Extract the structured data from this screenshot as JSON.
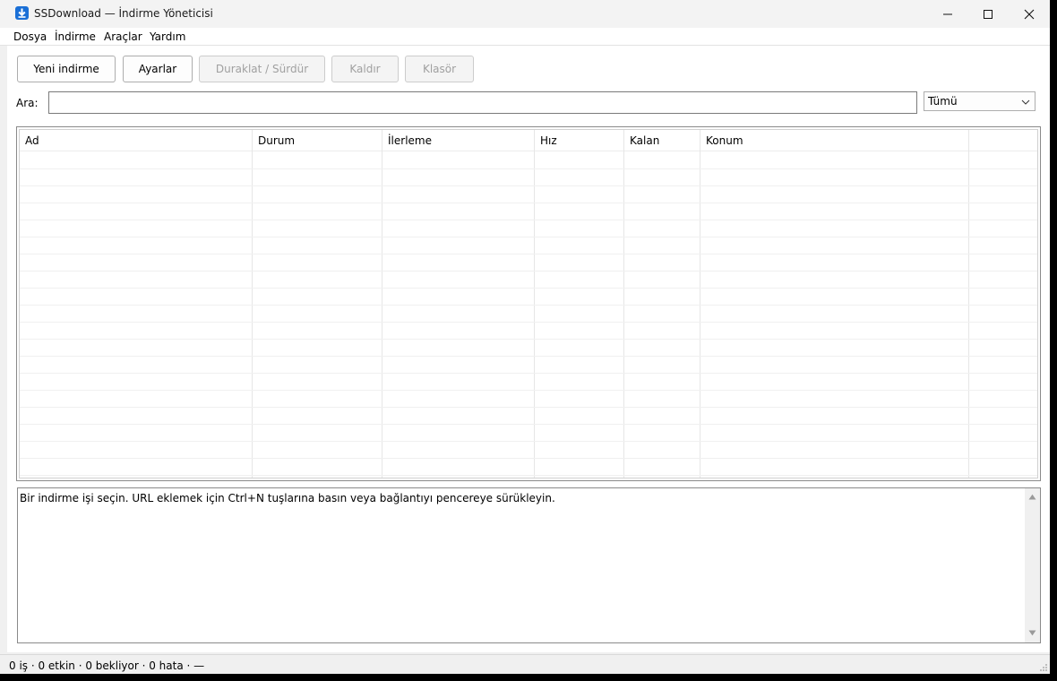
{
  "window": {
    "title": "SSDownload — İndirme Yöneticisi",
    "app_icon": "download-arrow-icon",
    "accent": "#1a6fd6"
  },
  "menu": [
    "Dosya",
    "İndirme",
    "Araçlar",
    "Yardım"
  ],
  "toolbar": {
    "new_download": "Yeni indirme",
    "settings": "Ayarlar",
    "pause_resume": "Duraklat / Sürdür",
    "remove": "Kaldır",
    "folder": "Klasör"
  },
  "search": {
    "label": "Ara:",
    "value": "",
    "filter_selected": "Tümü"
  },
  "table": {
    "columns": [
      "Ad",
      "Durum",
      "İlerleme",
      "Hız",
      "Kalan",
      "Konum"
    ],
    "rows": []
  },
  "log": {
    "message": "Bir indirme işi seçin. URL eklemek için Ctrl+N tuşlarına basın veya bağlantıyı pencereye sürükleyin."
  },
  "status": {
    "text": "0 iş · 0 etkin · 0 bekliyor · 0 hata · —"
  }
}
